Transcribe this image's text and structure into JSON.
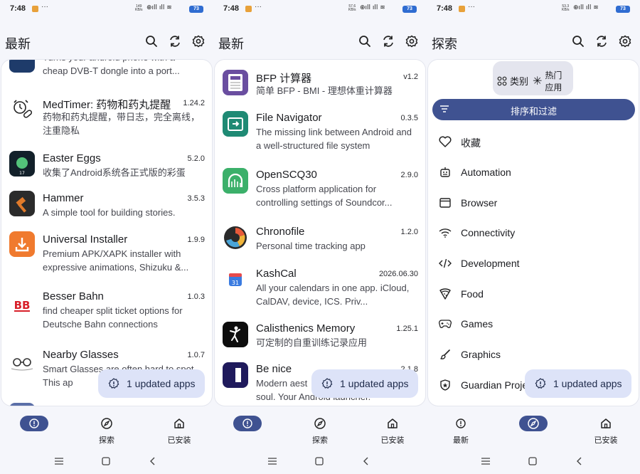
{
  "status": {
    "time": "7:48",
    "dots": "···",
    "speeds": [
      {
        "v": "149",
        "u": "KB/s"
      },
      {
        "v": "57.6",
        "u": "KB/s"
      },
      {
        "v": "53.3",
        "u": "KB/s"
      }
    ],
    "battery": "73"
  },
  "panels": [
    {
      "title": "最新"
    },
    {
      "title": "最新"
    },
    {
      "title": "探索"
    }
  ],
  "panel1": {
    "partial_desc": "Turns your android phone with a\ncheap DVB-T dongle into a port...",
    "apps": [
      {
        "name": "MedTimer: 药物和药丸提醒",
        "version": "1.24.2",
        "desc": "药物和药丸提醒，带日志，完全离线，注重隐私"
      },
      {
        "name": "Easter Eggs",
        "version": "5.2.0",
        "desc": "收集了Android系统各正式版的彩蛋"
      },
      {
        "name": "Hammer",
        "version": "3.5.3",
        "desc": "A simple tool for building stories."
      },
      {
        "name": "Universal Installer",
        "version": "1.9.9",
        "desc": "Premium APK/XAPK installer with expressive animations, Shizuku &..."
      },
      {
        "name": "Besser Bahn",
        "version": "1.0.3",
        "desc": "find cheaper split ticket options for Deutsche Bahn connections"
      },
      {
        "name": "Nearby Glasses",
        "version": "1.0.7",
        "desc": "Smart Glasses are often hard to spot. This ap"
      }
    ]
  },
  "panel2": {
    "apps": [
      {
        "name": "BFP 计算器",
        "version": "v1.2",
        "desc": "简单 BFP - BMI - 理想体重计算器"
      },
      {
        "name": "File Navigator",
        "version": "0.3.5",
        "desc": "The missing link between Android and a well-structured file system"
      },
      {
        "name": "OpenSCQ30",
        "version": "2.9.0",
        "desc": "Cross platform application for controlling settings of Soundcor..."
      },
      {
        "name": "Chronofile",
        "version": "1.2.0",
        "desc": "Personal time tracking app"
      },
      {
        "name": "KashCal",
        "version": "2026.06.30",
        "desc": "All your calendars in one app. iCloud, CalDAV, device, ICS. Priv..."
      },
      {
        "name": "Calisthenics Memory",
        "version": "1.25.1",
        "desc": "可定制的自重训练记录应用"
      },
      {
        "name": "Be nice",
        "version": "2.1.8",
        "desc": "Modern aest\nsoul. Your Android launcher."
      }
    ]
  },
  "panel3": {
    "chip_categories": "类别",
    "chip_popular": "热门\n应用",
    "sort_filter": "排序和过滤",
    "categories": [
      {
        "label": "收藏",
        "icon": "heart-icon"
      },
      {
        "label": "Automation",
        "icon": "robot-icon"
      },
      {
        "label": "Browser",
        "icon": "browser-icon"
      },
      {
        "label": "Connectivity",
        "icon": "wifi-icon"
      },
      {
        "label": "Development",
        "icon": "code-icon"
      },
      {
        "label": "Food",
        "icon": "pizza-icon"
      },
      {
        "label": "Games",
        "icon": "gamepad-icon"
      },
      {
        "label": "Graphics",
        "icon": "brush-icon"
      },
      {
        "label": "Guardian Proje",
        "icon": "shield-icon"
      }
    ]
  },
  "updated_pill": "1 updated apps",
  "bottom_nav": {
    "latest": "最新",
    "explore": "探索",
    "installed": "已安装"
  },
  "colors": {
    "accent": "#3f5291",
    "pill_bg": "#dde3f8",
    "panel_bg": "#f5f6fb"
  }
}
